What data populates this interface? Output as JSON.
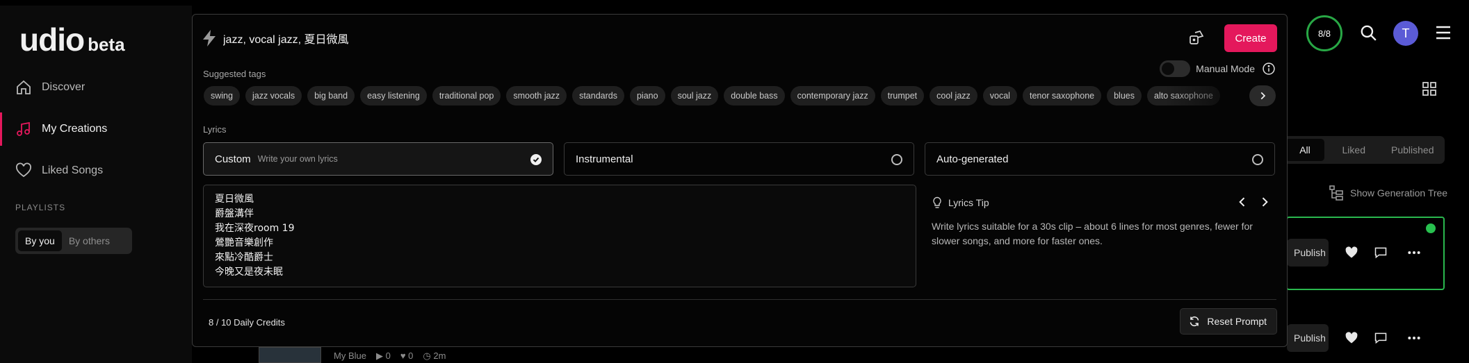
{
  "logo": {
    "mark": "udio",
    "suffix": "beta"
  },
  "sidebar": {
    "items": [
      {
        "label": "Discover"
      },
      {
        "label": "My Creations"
      },
      {
        "label": "Liked Songs"
      }
    ],
    "playlists_heading": "PLAYLISTS",
    "playlist_filter": {
      "options": [
        "By you",
        "By others"
      ],
      "selected": "By you"
    }
  },
  "header": {
    "credits_ring": "8/8",
    "avatar_initial": "T"
  },
  "library": {
    "tabs": [
      "All",
      "Liked",
      "Published"
    ],
    "selected_tab": "All",
    "generation_tree_label": "Show Generation Tree",
    "publish_label": "Publish",
    "background_song": {
      "title": "My Blue",
      "plays": "0",
      "likes": "0",
      "duration": "2m"
    }
  },
  "create": {
    "prompt_value": "jazz, vocal jazz, 夏日微風",
    "create_label": "Create",
    "suggested_tags_label": "Suggested tags",
    "manual_mode_label": "Manual Mode",
    "tags": [
      "swing",
      "jazz vocals",
      "big band",
      "easy listening",
      "traditional pop",
      "smooth jazz",
      "standards",
      "piano",
      "soul jazz",
      "double bass",
      "contemporary jazz",
      "trumpet",
      "cool jazz",
      "vocal",
      "tenor saxophone",
      "blues",
      "alto saxophone"
    ],
    "lyrics_label": "Lyrics",
    "lyrics_options": [
      {
        "name": "Custom",
        "hint": "Write your own lyrics",
        "selected": true
      },
      {
        "name": "Instrumental",
        "hint": "",
        "selected": false
      },
      {
        "name": "Auto-generated",
        "hint": "",
        "selected": false
      }
    ],
    "lyrics_text": "夏日微風\n爵盤溝伴\n我在深夜room 19\n鶯艷音樂創作\n來點冷酷爵士\n今晚又是夜未眠",
    "tip": {
      "title": "Lyrics Tip",
      "text": "Write lyrics suitable for a 30s clip – about 6 lines for most genres, fewer for slower songs, and more for faster ones."
    },
    "credits_text": "8 / 10 Daily Credits",
    "reset_label": "Reset Prompt"
  },
  "colors": {
    "accent": "#e4185c",
    "success": "#28a745",
    "avatar": "#5b5bd6"
  }
}
